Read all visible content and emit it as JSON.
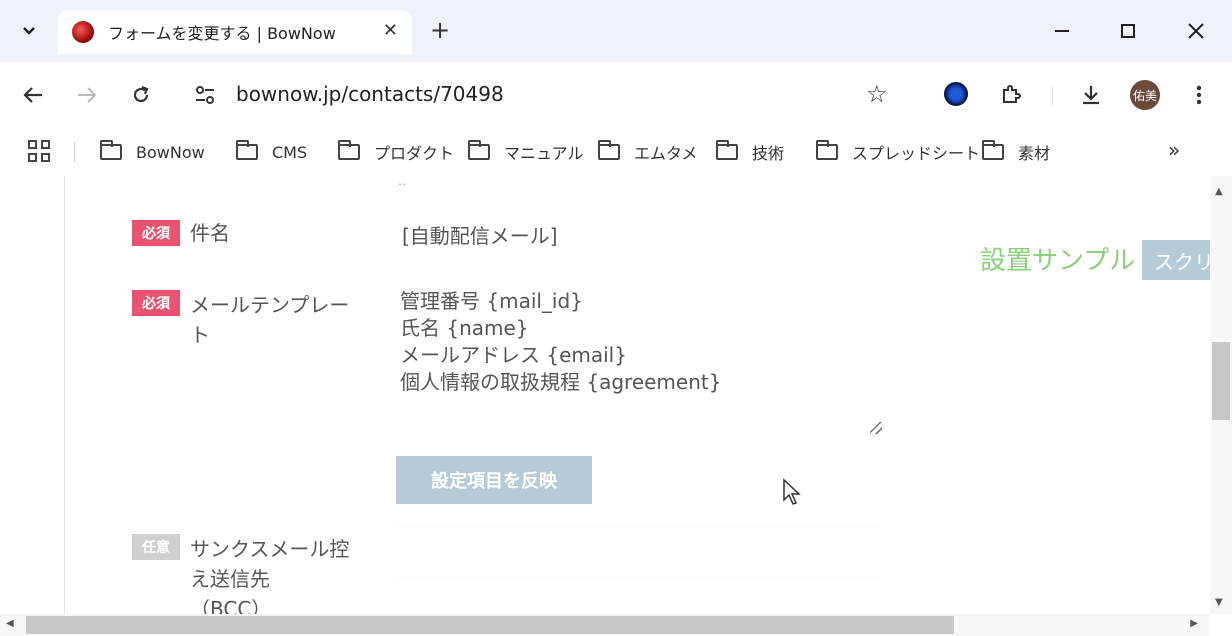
{
  "browser": {
    "tab_title": "フォームを変更する | BowNow",
    "url": "bownow.jp/contacts/70498",
    "avatar_text": "佑美",
    "bookmarks": [
      "BowNow",
      "CMS",
      "プロダクト",
      "マニュアル",
      "エムタメ",
      "技術",
      "スプレッドシート",
      "素材"
    ]
  },
  "form": {
    "subject": {
      "badge": "必須",
      "label": "件名",
      "value": "[自動配信メール]"
    },
    "template": {
      "badge": "必須",
      "label_line1": "メールテンプレー",
      "label_line2": "ト",
      "lines": [
        "管理番号 {mail_id}",
        "氏名 {name}",
        "メールアドレス {email}",
        "個人情報の取扱規程 {agreement}"
      ]
    },
    "apply_button": "設定項目を反映",
    "bcc": {
      "badge": "任意",
      "label_line1": "サンクスメール控",
      "label_line2": "え送信先",
      "label_line3": "（BCC）"
    }
  },
  "side": {
    "sample_link": "設置サンプル",
    "script_button": "スクリ"
  },
  "colors": {
    "required_badge": "#e8546f",
    "optional_badge": "#cfcfcf",
    "button_bg": "#b5ccd8",
    "sample_link": "#8bd07a"
  }
}
